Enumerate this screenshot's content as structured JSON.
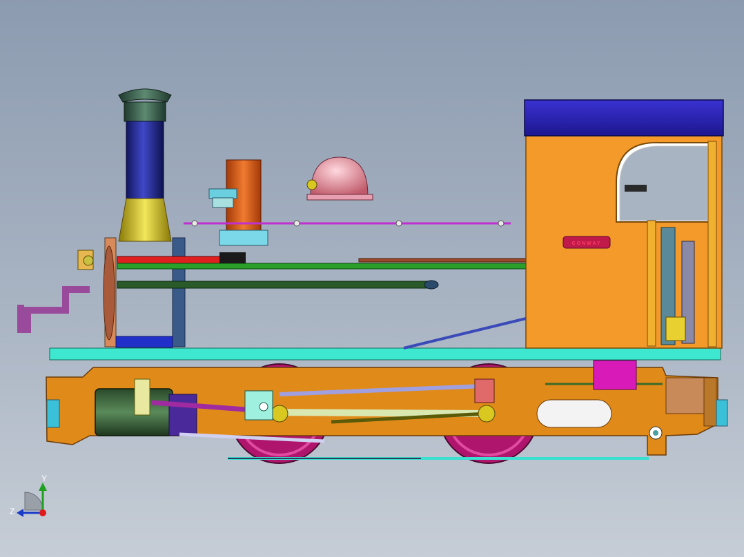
{
  "model": {
    "nameplate_text": "CONWAY"
  },
  "triad": {
    "y_label": "Y",
    "z_label": "Z"
  },
  "colors": {
    "background_top": "#8c9bb0",
    "background_bottom": "#c6cdd6",
    "cab": "#f39a2a",
    "cab_roof": "#2a20b4",
    "frame": "#e08a1a",
    "footplate": "#3ee8d0",
    "chimney": "#24298c",
    "chimney_base": "#d8c820",
    "wheels": "#c0187a",
    "dome": "#e89aa8",
    "sandbox": "#e05a14"
  }
}
